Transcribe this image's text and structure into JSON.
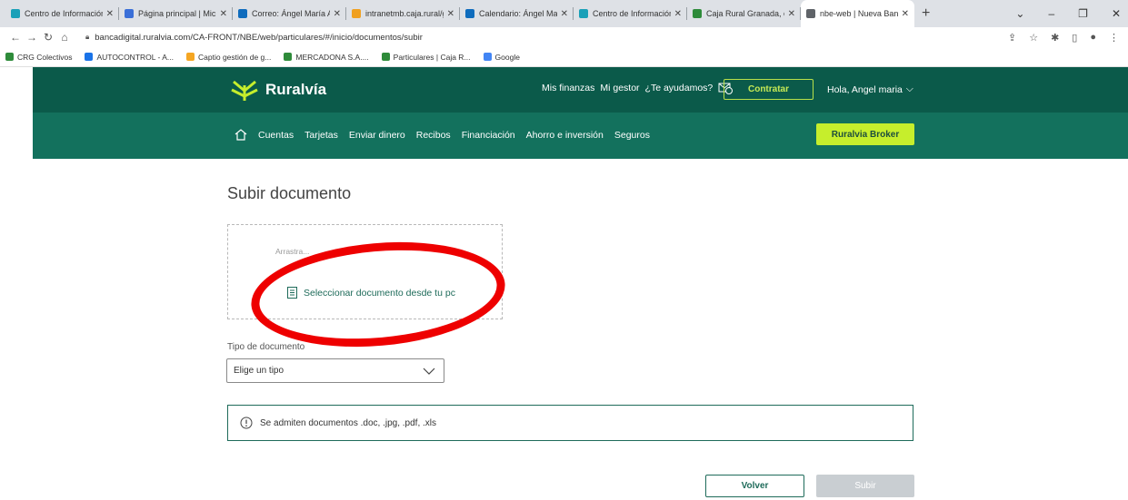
{
  "browser": {
    "tabs": [
      {
        "label": "Centro de Información CRG",
        "favicon_color": "#1aa0b8",
        "active": false
      },
      {
        "label": "Página principal | Microsoft",
        "favicon_color": "#3a6fd8",
        "active": false
      },
      {
        "label": "Correo: Ángel María Aguilar",
        "favicon_color": "#0f6cbd",
        "active": false
      },
      {
        "label": "intranetmb.caja.rural/grana",
        "favicon_color": "#f0a020",
        "active": false
      },
      {
        "label": "Calendario: Ángel María Ag",
        "favicon_color": "#0f6cbd",
        "active": false
      },
      {
        "label": "Centro de Información CRG",
        "favicon_color": "#1aa0b8",
        "active": false
      },
      {
        "label": "Caja Rural Granada, estamos",
        "favicon_color": "#2e8b3a",
        "active": false
      },
      {
        "label": "nbe-web | Nueva Banca Elec",
        "favicon_color": "#5f6368",
        "active": true
      }
    ],
    "new_tab_label": "+",
    "url": "bancadigital.ruralvia.com/CA-FRONT/NBE/web/particulares/#/inicio/documentos/subir",
    "bookmarks": [
      {
        "label": "CRG Colectivos",
        "icon_color": "#2e8b3a"
      },
      {
        "label": "AUTOCONTROL - A...",
        "icon_color": "#1a73e8"
      },
      {
        "label": "Captio gestión de g...",
        "icon_color": "#f5a623"
      },
      {
        "label": "MERCADONA S.A....",
        "icon_color": "#2e8b3a"
      },
      {
        "label": "Particulares | Caja R...",
        "icon_color": "#2e8b3a"
      },
      {
        "label": "Google",
        "icon_color": "#4285f4"
      }
    ]
  },
  "site": {
    "logo_text": "Ruralvía",
    "top_links": [
      "Mis finanzas",
      "Mi gestor",
      "¿Te ayudamos?"
    ],
    "contratar_label": "Contratar",
    "greeting": "Hola,  Angel maria",
    "main_nav": [
      "Cuentas",
      "Tarjetas",
      "Enviar dinero",
      "Recibos",
      "Financiación",
      "Ahorro e inversión",
      "Seguros"
    ],
    "broker_label": "Ruralvia Broker"
  },
  "page": {
    "title": "Subir documento",
    "drop_hint": "Arrastra...",
    "select_document_label": "Seleccionar documento desde tu pc",
    "doc_type_label": "Tipo de documento",
    "doc_type_placeholder": "Elige un tipo",
    "info_text": "Se admiten documentos .doc, .jpg, .pdf, .xls",
    "back_label": "Volver",
    "submit_label": "Subir"
  },
  "colors": {
    "header_dark": "#0b5a4a",
    "header_light": "#13715d",
    "accent_lime": "#c6ee2c",
    "annotation_red": "#ee0000"
  }
}
